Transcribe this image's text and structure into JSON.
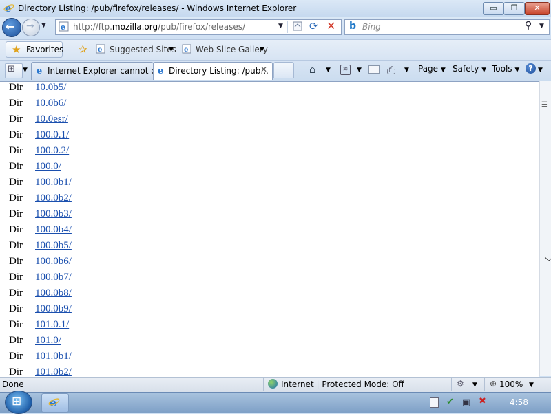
{
  "window": {
    "title": "Directory Listing: /pub/firefox/releases/ - Windows Internet Explorer",
    "minimize_glyph": "▭",
    "maximize_glyph": "❐",
    "close_glyph": "✕"
  },
  "address_bar": {
    "url_prefix": "http://ftp.",
    "url_domain": "mozilla.org",
    "url_path": "/pub/firefox/releases/"
  },
  "search": {
    "placeholder": "Bing",
    "search_glyph": "⚲"
  },
  "favorites_bar": {
    "favorites_label": "Favorites",
    "items": [
      {
        "label": "Suggested Sites"
      },
      {
        "label": "Web Slice Gallery"
      }
    ]
  },
  "tabs": [
    {
      "label": "Internet Explorer cannot d...",
      "active": false
    },
    {
      "label": "Directory Listing: /pub...",
      "active": true
    }
  ],
  "command_bar": {
    "page_label": "Page",
    "safety_label": "Safety",
    "tools_label": "Tools",
    "help_glyph": "?"
  },
  "listing": {
    "rows": [
      {
        "kind": "Dir",
        "name": "10.0b5/"
      },
      {
        "kind": "Dir",
        "name": "10.0b6/"
      },
      {
        "kind": "Dir",
        "name": "10.0esr/"
      },
      {
        "kind": "Dir",
        "name": "100.0.1/"
      },
      {
        "kind": "Dir",
        "name": "100.0.2/"
      },
      {
        "kind": "Dir",
        "name": "100.0/"
      },
      {
        "kind": "Dir",
        "name": "100.0b1/"
      },
      {
        "kind": "Dir",
        "name": "100.0b2/"
      },
      {
        "kind": "Dir",
        "name": "100.0b3/"
      },
      {
        "kind": "Dir",
        "name": "100.0b4/"
      },
      {
        "kind": "Dir",
        "name": "100.0b5/"
      },
      {
        "kind": "Dir",
        "name": "100.0b6/"
      },
      {
        "kind": "Dir",
        "name": "100.0b7/"
      },
      {
        "kind": "Dir",
        "name": "100.0b8/"
      },
      {
        "kind": "Dir",
        "name": "100.0b9/"
      },
      {
        "kind": "Dir",
        "name": "101.0.1/"
      },
      {
        "kind": "Dir",
        "name": "101.0/"
      },
      {
        "kind": "Dir",
        "name": "101.0b1/"
      },
      {
        "kind": "Dir",
        "name": "101.0b2/"
      }
    ]
  },
  "status_bar": {
    "status": "Done",
    "zone": "Internet | Protected Mode: Off",
    "zoom": "100%"
  },
  "taskbar": {
    "clock": "4:58"
  },
  "colors": {
    "link": "#1a4fae",
    "chrome": "#cfe0f3",
    "accent": "#1d4f98"
  },
  "icons": {
    "back": "back-arrow-icon",
    "forward": "forward-arrow-icon",
    "refresh": "refresh-icon",
    "stop": "stop-icon",
    "home": "home-icon",
    "print": "print-icon"
  }
}
